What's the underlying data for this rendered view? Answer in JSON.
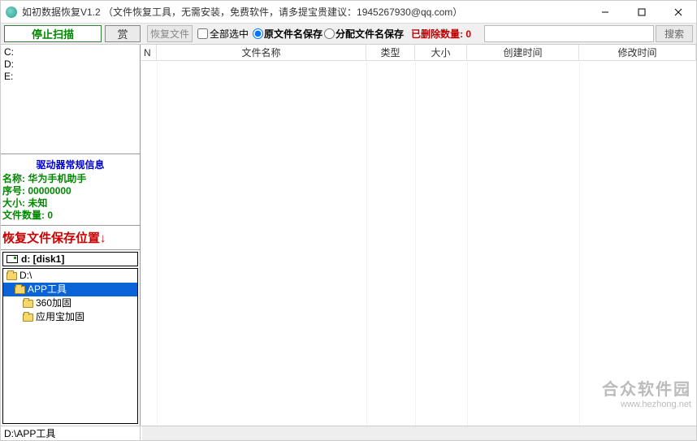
{
  "titlebar": {
    "text": "如初数据恢复V1.2 （文件恢复工具，无需安装，免费软件，请多提宝贵建议：1945267930@qq.com）"
  },
  "toolbar": {
    "stop_scan": "停止扫描",
    "reward": "赏",
    "recover_files": "恢复文件",
    "select_all": "全部选中",
    "save_original_name": "原文件名保存",
    "save_assigned_name": "分配文件名保存",
    "deleted_count_label": "已删除数量: 0",
    "search_btn": "搜索"
  },
  "drives": {
    "items": [
      "C:",
      "D:",
      "E:"
    ]
  },
  "drive_info": {
    "title": "驱动器常规信息",
    "name_label": "名称:",
    "name_value": "华为手机助手",
    "serial_label": "序号:",
    "serial_value": "00000000",
    "size_label": "大小:",
    "size_value": "未知",
    "count_label": "文件数量:",
    "count_value": "0"
  },
  "save_location_title": "恢复文件保存位置↓",
  "dest_drive": "d: [disk1]",
  "folder_tree": {
    "root": "D:\\",
    "items": [
      {
        "label": "APP工具",
        "selected": true
      },
      {
        "label": "360加固",
        "selected": false
      },
      {
        "label": "应用宝加固",
        "selected": false
      }
    ]
  },
  "columns": {
    "n": "N",
    "filename": "文件名称",
    "type": "类型",
    "size": "大小",
    "created": "创建时间",
    "modified": "修改时间"
  },
  "statusbar": {
    "path": "D:\\APP工具"
  },
  "watermark": {
    "line1": "合众软件园",
    "line2": "www.hezhong.net"
  }
}
